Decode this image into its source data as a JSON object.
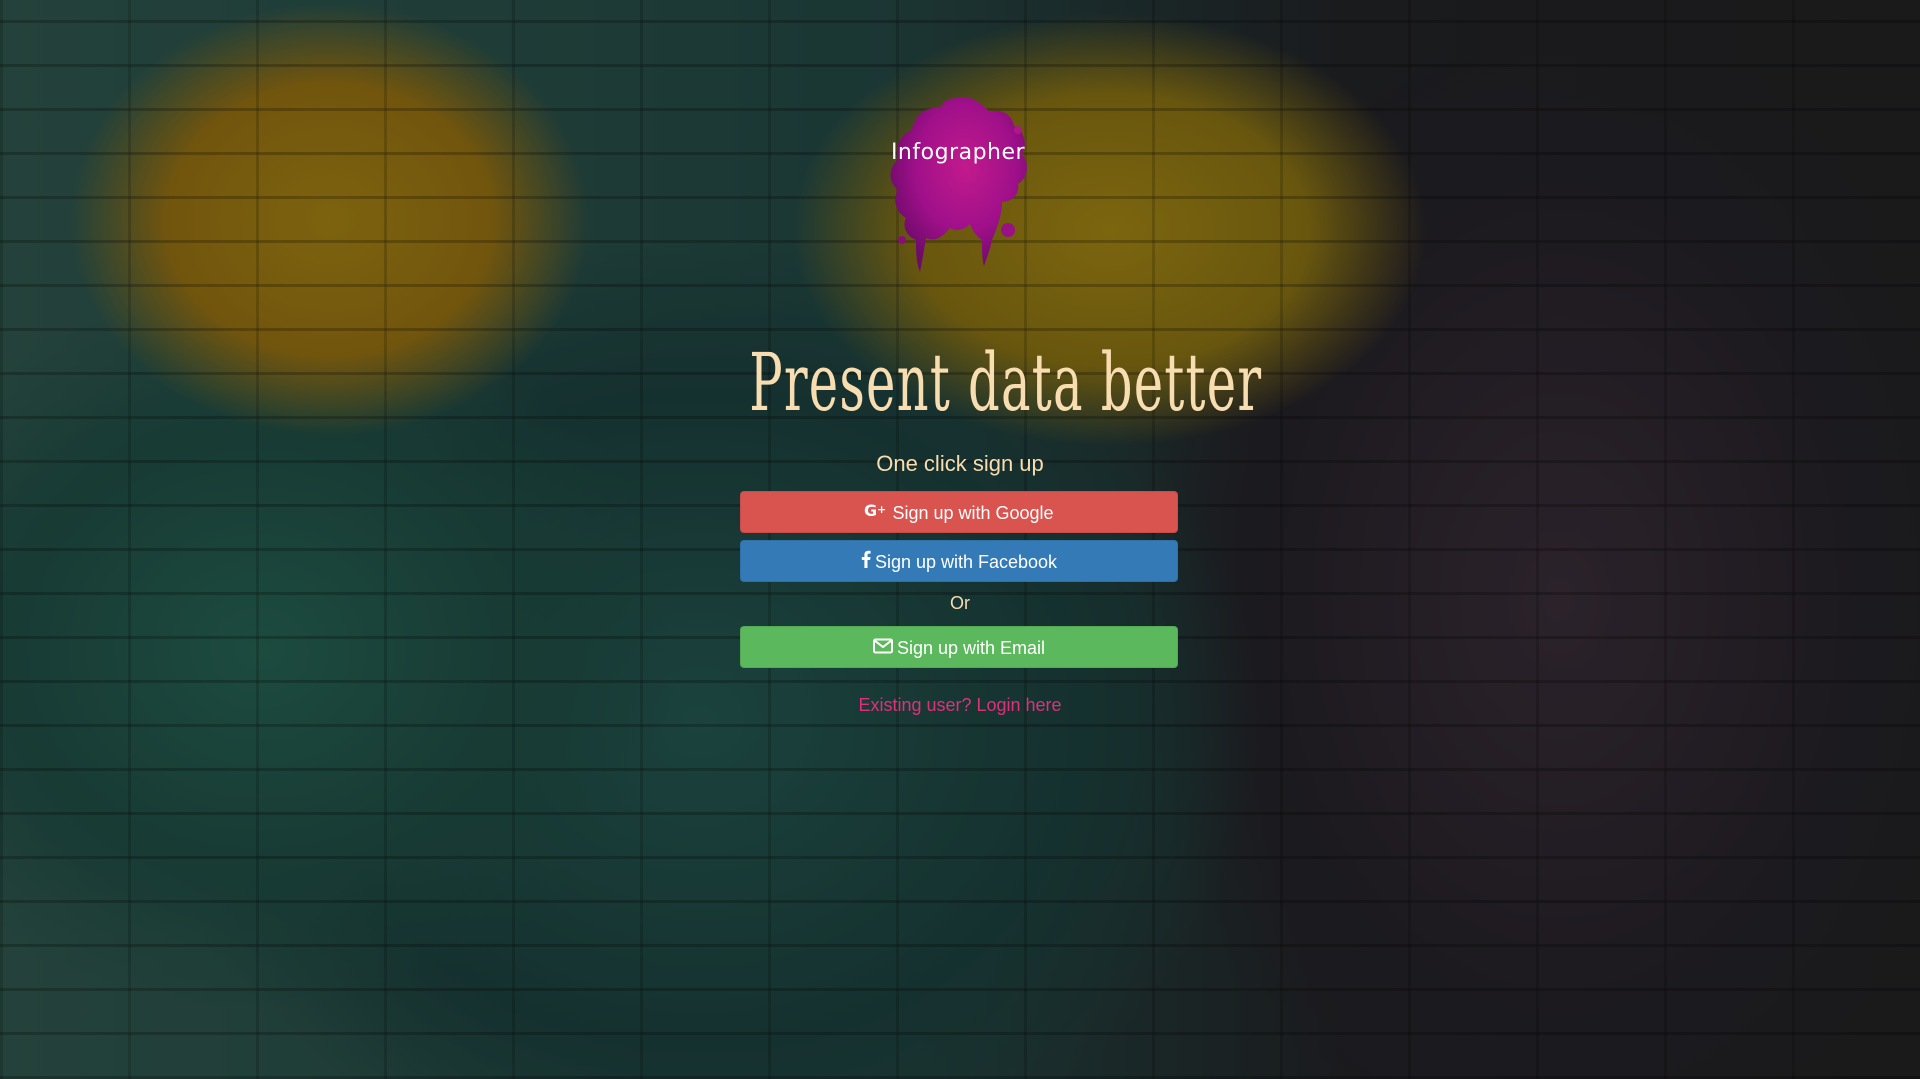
{
  "logo": {
    "text": "Infographer",
    "icon": "paint-splat-logo"
  },
  "hero": {
    "headline": "Present data better",
    "subheading": "One click sign up"
  },
  "signup": {
    "google_label": "Sign up with Google",
    "google_icon": "google-plus-icon",
    "facebook_label": "Sign up with Facebook",
    "facebook_icon": "facebook-icon",
    "divider_text": "Or",
    "email_label": "Sign up with Email",
    "email_icon": "envelope-icon"
  },
  "login": {
    "link_text": "Existing user? Login here"
  },
  "colors": {
    "google": "#d9534f",
    "facebook": "#337ab7",
    "email": "#5cb85c",
    "link": "#e0307a",
    "text": "#f7ddb0"
  }
}
